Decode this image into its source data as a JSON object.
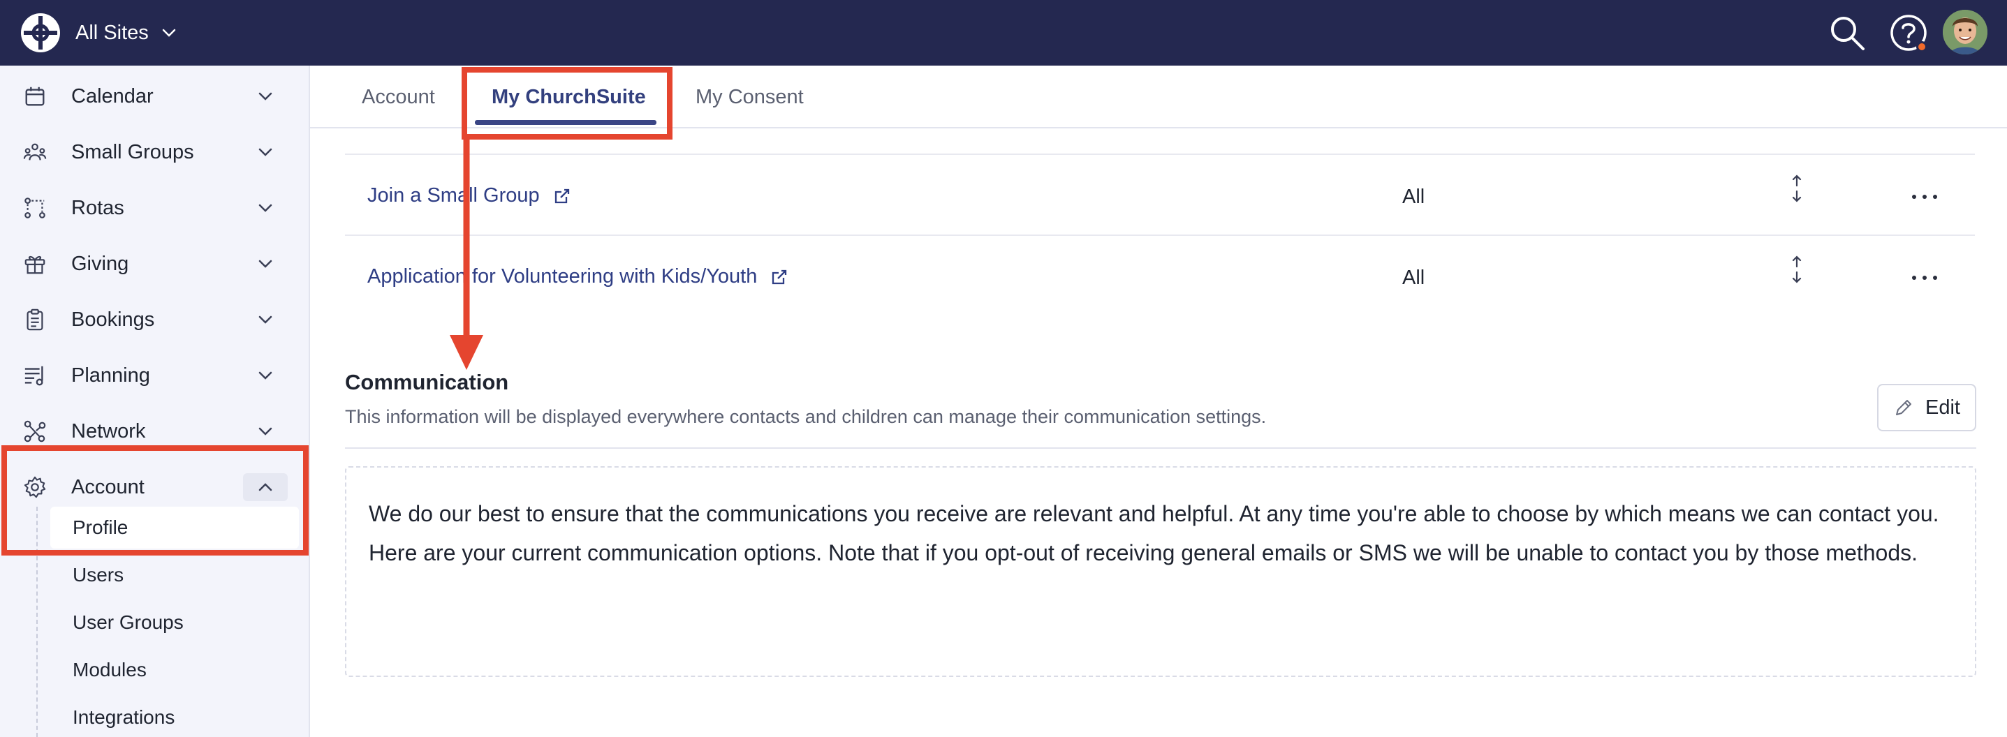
{
  "header": {
    "site_switcher": "All Sites",
    "icons": [
      "logo-icon",
      "search-icon",
      "help-icon",
      "avatar"
    ],
    "colors": {
      "background": "#242850",
      "notification": "#f26a2a"
    }
  },
  "sidebar": {
    "items": [
      {
        "label": "Calendar",
        "icon": "calendar-icon"
      },
      {
        "label": "Small Groups",
        "icon": "people-icon"
      },
      {
        "label": "Rotas",
        "icon": "rotas-icon"
      },
      {
        "label": "Giving",
        "icon": "gift-icon"
      },
      {
        "label": "Bookings",
        "icon": "clipboard-icon"
      },
      {
        "label": "Planning",
        "icon": "planning-icon"
      },
      {
        "label": "Network",
        "icon": "network-icon"
      },
      {
        "label": "Account",
        "icon": "gear-icon",
        "expanded": true
      }
    ],
    "subitems": [
      {
        "label": "Profile",
        "active": true
      },
      {
        "label": "Users"
      },
      {
        "label": "User Groups"
      },
      {
        "label": "Modules"
      },
      {
        "label": "Integrations"
      }
    ]
  },
  "tabs": [
    {
      "label": "Account"
    },
    {
      "label": "My ChurchSuite",
      "active": true
    },
    {
      "label": "My Consent"
    }
  ],
  "list": {
    "rows": [
      {
        "title": "Join a Small Group",
        "audience": "All"
      },
      {
        "title": "Application for Volunteering with Kids/Youth",
        "audience": "All"
      }
    ]
  },
  "communication": {
    "title": "Communication",
    "subtitle": "This information will be displayed everywhere contacts and children can manage their communication settings.",
    "edit_label": "Edit",
    "body": "We do our best to ensure that the communications you receive are relevant and helpful. At any time you're able to choose by which means we can contact you. Here are your current communication options. Note that if you opt-out of receiving general emails or SMS we will be unable to contact you by those methods."
  },
  "annotations": {
    "color": "#e5452f"
  }
}
